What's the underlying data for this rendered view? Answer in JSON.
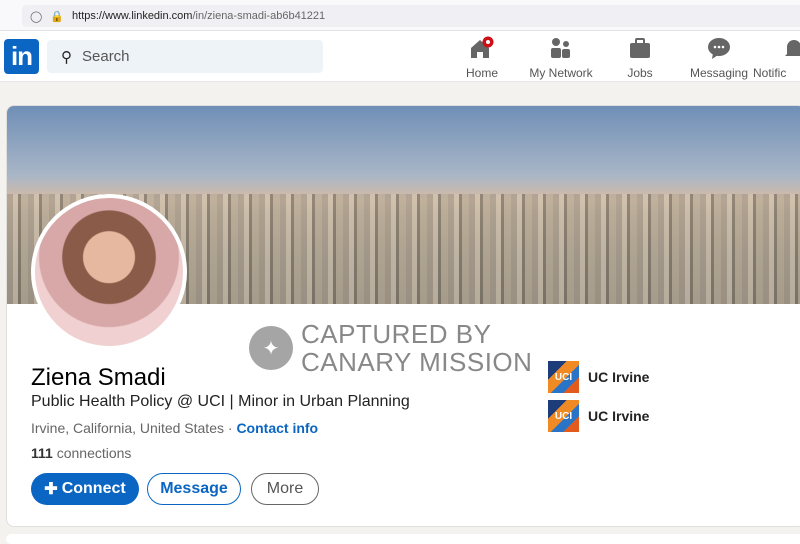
{
  "browser": {
    "url_domain": "https://www.linkedin.com",
    "url_path": "/in/ziena-smadi-ab6b41221"
  },
  "nav": {
    "logo": "in",
    "search_placeholder": "Search",
    "items": [
      {
        "label": "Home",
        "icon": "home-icon"
      },
      {
        "label": "My Network",
        "icon": "network-icon"
      },
      {
        "label": "Jobs",
        "icon": "briefcase-icon"
      },
      {
        "label": "Messaging",
        "icon": "chat-icon"
      },
      {
        "label": "Notific",
        "icon": "bell-icon"
      }
    ]
  },
  "watermark": {
    "line1": "CAPTURED BY",
    "line2": "CANARY MISSION"
  },
  "profile": {
    "name": "Ziena Smadi",
    "headline": "Public Health Policy @ UCI | Minor in Urban Planning",
    "location": "Irvine, California, United States",
    "separator": " · ",
    "contact": "Contact info",
    "connections_count": "111",
    "connections_label": " connections"
  },
  "actions": {
    "connect": "Connect",
    "message": "Message",
    "more": "More"
  },
  "orgs": [
    {
      "logo": "UCI",
      "name": "UC Irvine"
    },
    {
      "logo": "UCI",
      "name": "UC Irvine"
    }
  ],
  "colors": {
    "brand": "#0a66c2",
    "badge": "#cc1016"
  }
}
